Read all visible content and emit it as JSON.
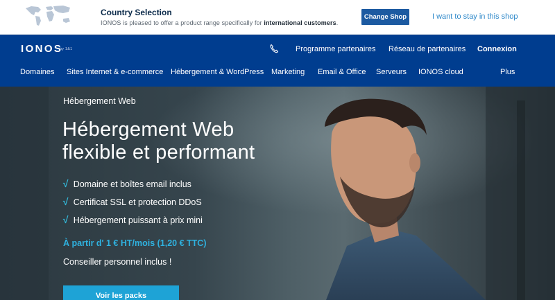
{
  "country_bar": {
    "title": "Country Selection",
    "text_prefix": "IONOS is pleased to offer a product range specifically for ",
    "text_bold": "international customers",
    "text_suffix": ".",
    "change_shop_label": "Change Shop",
    "stay_label": "I want to stay in this shop"
  },
  "nav": {
    "logo": "IONOS",
    "logo_by": "by 1&1",
    "top_links": [
      "Programme partenaires",
      "Réseau de partenaires",
      "Connexion"
    ],
    "menu": [
      "Domaines",
      "Sites Internet & e-commerce",
      "Hébergement & WordPress",
      "Marketing",
      "Email & Office",
      "Serveurs",
      "IONOS cloud",
      "Plus"
    ]
  },
  "hero": {
    "eyebrow": "Hébergement Web",
    "headline_line1": "Hébergement Web",
    "headline_line2": "flexible et performant",
    "bullets": [
      "Domaine et boîtes email inclus",
      "Certificat SSL et protection DDoS",
      "Hébergement puissant à prix mini"
    ],
    "price": "À partir d' 1 € HT/mois (1,20 € TTC)",
    "advisor": "Conseiller personnel inclus !",
    "cta_label": "Voir les packs"
  },
  "colors": {
    "nav_blue": "#003d8f",
    "button_blue": "#1c5aa1",
    "link_blue": "#2a86c8",
    "accent_cyan": "#1ea3d6"
  },
  "icons": [
    "world-map-icon",
    "phone-icon",
    "check-icon"
  ]
}
